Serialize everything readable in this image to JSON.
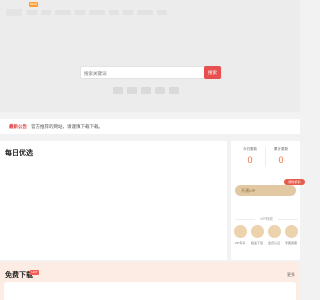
{
  "header": {
    "new_badge": "NEW"
  },
  "search": {
    "placeholder": "搜索关键词",
    "button": "搜索"
  },
  "notice": {
    "label": "最新公告",
    "text": "官方推荐的网站，请谨慎下载下载。"
  },
  "daily": {
    "title": "每日优选"
  },
  "stats": {
    "today_label": "今日更新",
    "today_value": "0",
    "total_label": "累计更新",
    "total_value": "0"
  },
  "vip": {
    "button": "开通VIP",
    "badge": "限时折扣",
    "privileges_label": "VIP特权",
    "perks": [
      {
        "label": "VIP专享"
      },
      {
        "label": "极速下载"
      },
      {
        "label": "会员认证"
      },
      {
        "label": "专属客服"
      }
    ]
  },
  "free": {
    "title": "免费下载",
    "badge": "HOT",
    "more": "更多"
  },
  "colors": {
    "accent_red": "#e84f4f",
    "stat_orange": "#f26a3b",
    "vip_gold": "#e3c9a3",
    "free_bg": "#fdece4"
  }
}
